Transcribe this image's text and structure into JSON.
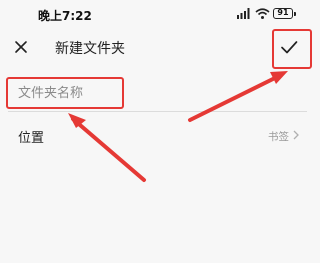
{
  "status_bar": {
    "time": "晚上7:22",
    "battery": "91"
  },
  "header": {
    "title": "新建文件夹",
    "close_icon": "close-icon",
    "confirm_icon": "checkmark-icon"
  },
  "form": {
    "name_placeholder": "文件夹名称",
    "location_label": "位置",
    "location_value": "书签"
  },
  "colors": {
    "annotation": "#e53935",
    "background": "#f7f7f7"
  }
}
